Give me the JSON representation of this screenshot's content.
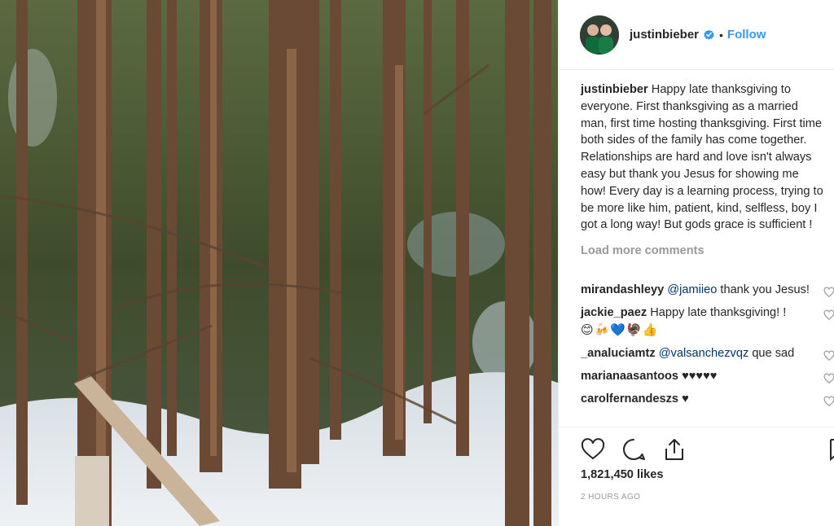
{
  "post": {
    "username": "justinbieber",
    "verified": true,
    "separator": "•",
    "follow_label": "Follow",
    "caption_username": "justinbieber",
    "caption_text": "Happy late thanksgiving to everyone. First thanksgiving as a married man, first time hosting thanksgiving. First time both sides of the family has come together. Relationships are hard and love isn't always easy but thank you Jesus for showing me how! Every day is a learning process, trying to be more like him, patient, kind, selfless, boy I got a long way! But gods grace is sufficient !",
    "load_more_label": "Load more comments",
    "likes": "1,821,450 likes",
    "timestamp": "2 HOURS AGO"
  },
  "comments": [
    {
      "username": "mirandashleyy",
      "mention": "@jamiieo",
      "text": " thank you Jesus!"
    },
    {
      "username": "jackie_paez",
      "mention": "",
      "text": " Happy late thanksgiving! !",
      "emojis": "😊🍻💙🦃👍"
    },
    {
      "username": "_analuciamtz",
      "mention": "@valsanchezvqz",
      "text": " que sad"
    },
    {
      "username": "marianaasantoos",
      "mention": "",
      "text": " ♥♥♥♥♥"
    },
    {
      "username": "carolfernandeszs",
      "mention": "",
      "text": " ♥"
    }
  ],
  "icons": {
    "like": "heart-icon",
    "comment": "comment-bubble-icon",
    "share": "share-icon",
    "save": "bookmark-icon",
    "verified": "verified-badge-icon"
  },
  "colors": {
    "link_blue": "#3897f0",
    "mention_blue": "#003569",
    "muted_gray": "#999999",
    "text": "#262626"
  }
}
